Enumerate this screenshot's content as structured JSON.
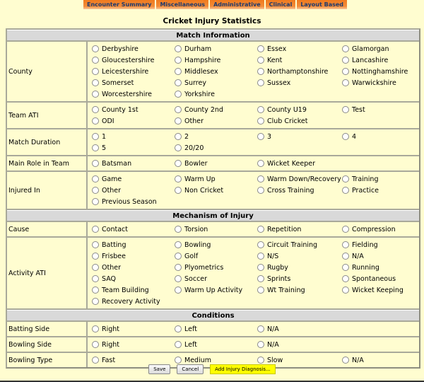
{
  "tabs": [
    "Encounter Summary",
    "Miscellaneous",
    "Administrative",
    "Clinical",
    "Layout Based"
  ],
  "page_title": "Cricket Injury Statistics",
  "sections": [
    {
      "title": "Match Information",
      "rows": [
        {
          "label": "County",
          "options": [
            "Derbyshire",
            "Durham",
            "Essex",
            "Glamorgan",
            "Gloucestershire",
            "Hampshire",
            "Kent",
            "Lancashire",
            "Leicestershire",
            "Middlesex",
            "Northamptonshire",
            "Nottinghamshire",
            "Somerset",
            "Surrey",
            "Sussex",
            "Warwickshire",
            "Worcestershire",
            "Yorkshire"
          ]
        },
        {
          "label": "Team ATI",
          "options": [
            "County 1st",
            "County 2nd",
            "County U19",
            "Test",
            "ODI",
            "Other",
            "Club Cricket"
          ]
        },
        {
          "label": "Match Duration",
          "options": [
            "1",
            "2",
            "3",
            "4",
            "5",
            "20/20"
          ]
        },
        {
          "label": "Main Role in Team",
          "options": [
            "Batsman",
            "Bowler",
            "Wicket Keeper"
          ]
        },
        {
          "label": "Injured In",
          "options": [
            "Game",
            "Warm Up",
            "Warm Down/Recovery",
            "Training",
            "Other",
            "Non Cricket",
            "Cross Training",
            "Practice",
            "Previous Season"
          ]
        }
      ]
    },
    {
      "title": "Mechanism of Injury",
      "rows": [
        {
          "label": "Cause",
          "options": [
            "Contact",
            "Torsion",
            "Repetition",
            "Compression"
          ]
        },
        {
          "label": "Activity ATI",
          "options": [
            "Batting",
            "Bowling",
            "Circuit Training",
            "Fielding",
            "Frisbee",
            "Golf",
            "N/S",
            "N/A",
            "Other",
            "Plyometrics",
            "Rugby",
            "Running",
            "SAQ",
            "Soccer",
            "Sprints",
            "Spontaneous",
            "Team Building",
            "Warm Up Activity",
            "Wt Training",
            "Wicket Keeping",
            "Recovery Activity"
          ]
        }
      ]
    },
    {
      "title": "Conditions",
      "rows": [
        {
          "label": "Batting Side",
          "options": [
            "Right",
            "Left",
            "N/A"
          ]
        },
        {
          "label": "Bowling Side",
          "options": [
            "Right",
            "Left",
            "N/A"
          ]
        },
        {
          "label": "Bowling Type",
          "options": [
            "Fast",
            "Medium",
            "Slow",
            "N/A"
          ]
        }
      ]
    }
  ],
  "buttons": {
    "save": "Save",
    "cancel": "Cancel",
    "add_diagnosis": "Add Injury Diagnosis..."
  }
}
